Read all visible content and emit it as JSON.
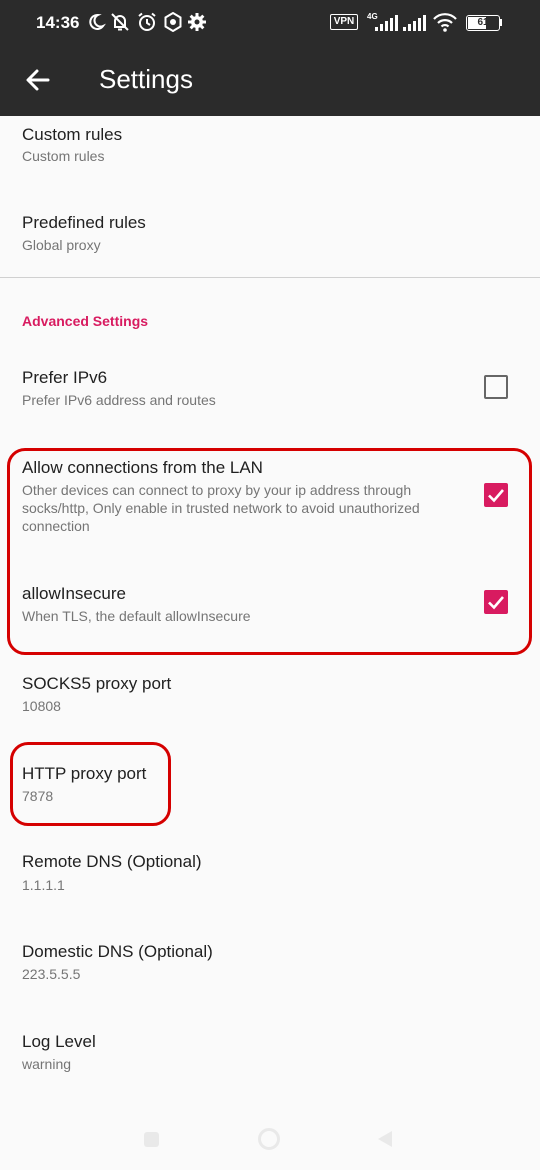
{
  "status_bar": {
    "time": "14:36",
    "vpn": "VPN",
    "network": "4G",
    "battery": "61",
    "battery_level": 0.61,
    "icons": [
      "moon-icon",
      "notifications-off-icon",
      "alarm-icon",
      "gear-badge-icon",
      "settings-icon",
      "signal-icon",
      "signal-icon",
      "wifi-icon",
      "battery-icon"
    ]
  },
  "app_bar": {
    "title": "Settings",
    "back_icon": "arrow-back-icon"
  },
  "routing": [
    {
      "title": "Custom rules",
      "summary": "Custom rules"
    },
    {
      "title": "Predefined rules",
      "summary": "Global proxy"
    }
  ],
  "advanced": {
    "header": "Advanced Settings",
    "prefer_ipv6": {
      "title": "Prefer IPv6",
      "summary": "Prefer IPv6 address and routes",
      "checked": false
    },
    "allow_lan": {
      "title": "Allow connections from the LAN",
      "summary": "Other devices can connect to proxy by your ip address through socks/http, Only enable in trusted network to avoid unauthorized connection",
      "checked": true
    },
    "allow_insecure": {
      "title": "allowInsecure",
      "summary": "When TLS, the default allowInsecure",
      "checked": true
    },
    "socks_port": {
      "title": "SOCKS5 proxy port",
      "summary": "10808"
    },
    "http_port": {
      "title": "HTTP proxy port",
      "summary": "7878"
    },
    "remote_dns": {
      "title": "Remote DNS (Optional)",
      "summary": "1.1.1.1"
    },
    "domestic_dns": {
      "title": "Domestic DNS (Optional)",
      "summary": "223.5.5.5"
    },
    "log_level": {
      "title": "Log Level",
      "summary": "warning"
    }
  },
  "colors": {
    "accent": "#d81b60",
    "app_bar": "#2b2b2b",
    "highlight": "#d50000",
    "background": "#fafafa"
  }
}
